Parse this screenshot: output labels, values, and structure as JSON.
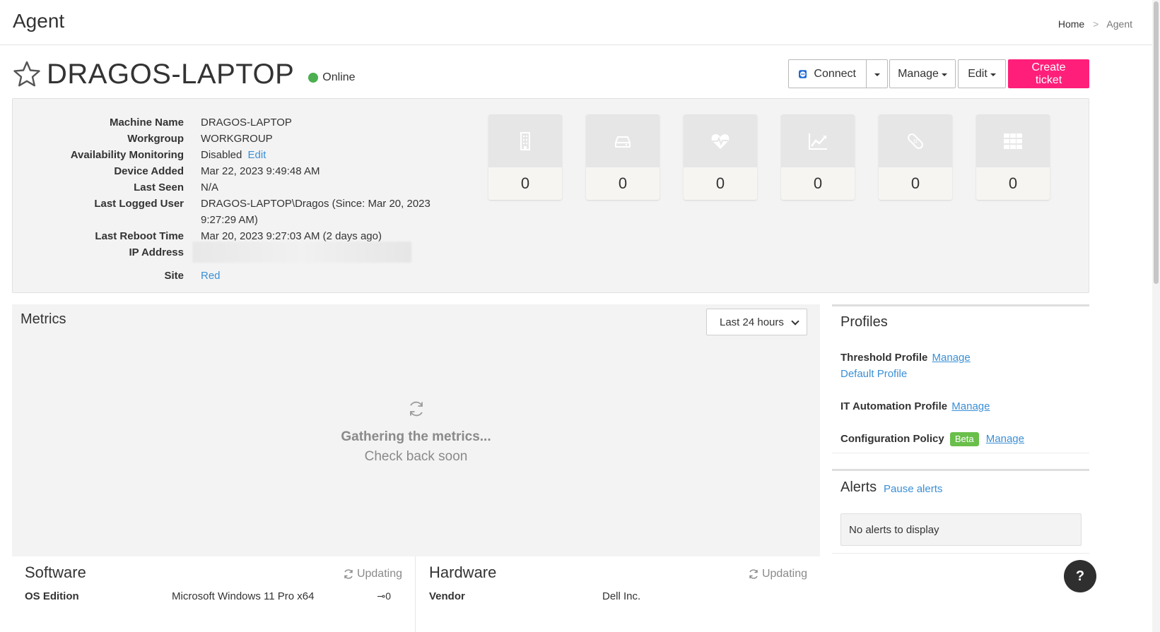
{
  "header": {
    "title": "Agent",
    "breadcrumb": {
      "home": "Home",
      "separator": ">",
      "current": "Agent"
    }
  },
  "device": {
    "name": "DRAGOS-LAPTOP",
    "status": "Online",
    "status_color": "#4caf50"
  },
  "actions": {
    "connect": "Connect",
    "manage": "Manage",
    "edit": "Edit",
    "create_ticket": "Create ticket",
    "ticket_color": "#ff1f7a"
  },
  "info": {
    "machine_name": {
      "label": "Machine Name",
      "value": "DRAGOS-LAPTOP"
    },
    "workgroup": {
      "label": "Workgroup",
      "value": "WORKGROUP"
    },
    "availability": {
      "label": "Availability Monitoring",
      "value": "Disabled",
      "link": "Edit"
    },
    "device_added": {
      "label": "Device Added",
      "value": "Mar 22, 2023 9:49:48 AM"
    },
    "last_seen": {
      "label": "Last Seen",
      "value": "N/A"
    },
    "last_user": {
      "label": "Last Logged User",
      "value": "DRAGOS-LAPTOP\\Dragos (Since: Mar 20, 2023 9:27:29 AM)"
    },
    "last_reboot": {
      "label": "Last Reboot Time",
      "value": "Mar 20, 2023 9:27:03 AM (2 days ago)"
    },
    "ip": {
      "label": "IP Address"
    },
    "site": {
      "label": "Site",
      "value": "Red"
    }
  },
  "tiles": [
    {
      "icon": "building-icon",
      "count": "0"
    },
    {
      "icon": "hard-drive-icon",
      "count": "0"
    },
    {
      "icon": "heartbeat-icon",
      "count": "0"
    },
    {
      "icon": "chart-line-icon",
      "count": "0"
    },
    {
      "icon": "bandage-icon",
      "count": "0"
    },
    {
      "icon": "apps-grid-icon",
      "count": "0"
    }
  ],
  "metrics": {
    "title": "Metrics",
    "range": "Last 24 hours",
    "gathering": "Gathering the metrics...",
    "check_back": "Check back soon"
  },
  "profiles": {
    "title": "Profiles",
    "threshold": {
      "label": "Threshold Profile",
      "manage": "Manage",
      "value": "Default Profile"
    },
    "automation": {
      "label": "IT Automation Profile",
      "manage": "Manage"
    },
    "config": {
      "label": "Configuration Policy",
      "badge": "Beta",
      "manage": "Manage"
    }
  },
  "alerts": {
    "title": "Alerts",
    "pause": "Pause alerts",
    "empty": "No alerts to display"
  },
  "software": {
    "title": "Software",
    "updating": "Updating",
    "row_label": "OS Edition",
    "row_value": "Microsoft Windows 11 Pro x64"
  },
  "hardware": {
    "title": "Hardware",
    "updating": "Updating",
    "row_label": "Vendor",
    "row_value": "Dell Inc."
  },
  "help": "?"
}
